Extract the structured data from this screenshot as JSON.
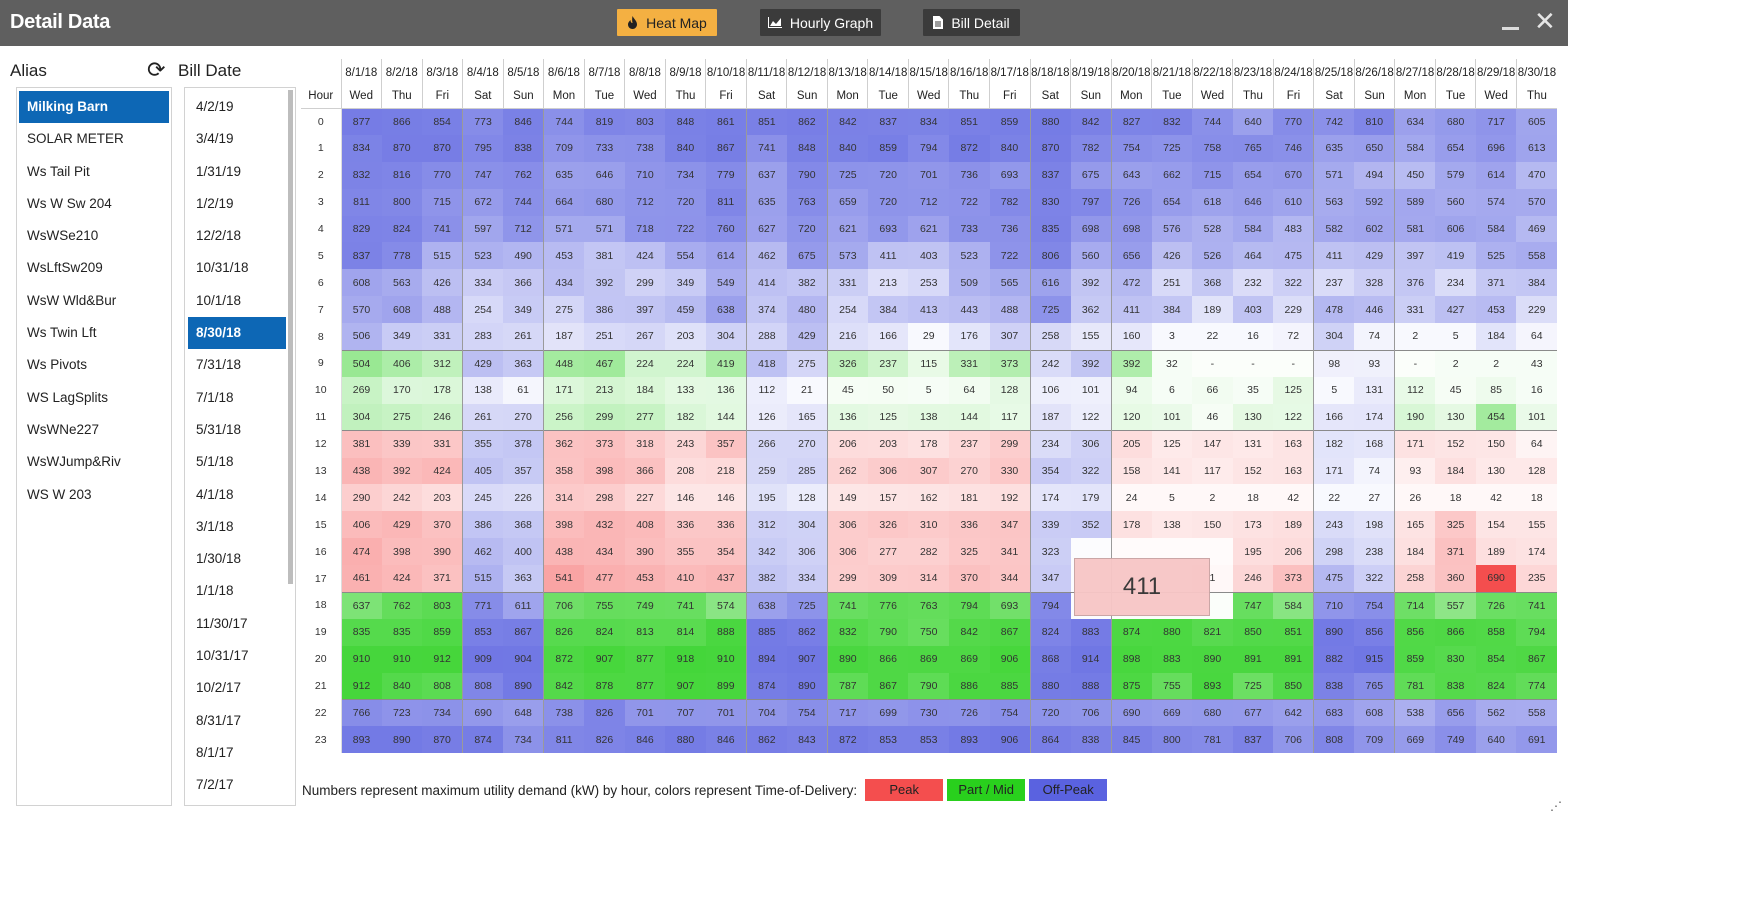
{
  "window": {
    "title": "Detail Data"
  },
  "toolbar": {
    "heat_map": "Heat Map",
    "hourly_graph": "Hourly Graph",
    "bill_detail": "Bill Detail"
  },
  "alias": {
    "heading": "Alias",
    "items": [
      "Milking Barn",
      "SOLAR METER",
      "Ws Tail Pit",
      "Ws W Sw 204",
      "WsWSe210",
      "WsLftSw209",
      "WsW Wld&Bur",
      "Ws Twin Lft",
      "Ws Pivots",
      "WS LagSplits",
      "WsWNe227",
      "WsWJump&Riv",
      "WS W 203"
    ],
    "selected_index": 0
  },
  "bill": {
    "heading": "Bill Date",
    "items": [
      "4/2/19",
      "3/4/19",
      "1/31/19",
      "1/2/19",
      "12/2/18",
      "10/31/18",
      "10/1/18",
      "8/30/18",
      "7/31/18",
      "7/1/18",
      "5/31/18",
      "5/1/18",
      "4/1/18",
      "3/1/18",
      "1/30/18",
      "1/1/18",
      "11/30/17",
      "10/31/17",
      "10/2/17",
      "8/31/17",
      "8/1/17",
      "7/2/17"
    ],
    "selected_index": 7
  },
  "heatmap": {
    "hour_label": "Hour",
    "dates": [
      "8/1/18",
      "8/2/18",
      "8/3/18",
      "8/4/18",
      "8/5/18",
      "8/6/18",
      "8/7/18",
      "8/8/18",
      "8/9/18",
      "8/10/18",
      "8/11/18",
      "8/12/18",
      "8/13/18",
      "8/14/18",
      "8/15/18",
      "8/16/18",
      "8/17/18",
      "8/18/18",
      "8/19/18",
      "8/20/18",
      "8/21/18",
      "8/22/18",
      "8/23/18",
      "8/24/18",
      "8/25/18",
      "8/26/18",
      "8/27/18",
      "8/28/18",
      "8/29/18",
      "8/30/18"
    ],
    "days": [
      "Wed",
      "Thu",
      "Fri",
      "Sat",
      "Sun",
      "Mon",
      "Tue",
      "Wed",
      "Thu",
      "Fri",
      "Sat",
      "Sun",
      "Mon",
      "Tue",
      "Wed",
      "Thu",
      "Fri",
      "Sat",
      "Sun",
      "Mon",
      "Tue",
      "Wed",
      "Thu",
      "Fri",
      "Sat",
      "Sun",
      "Mon",
      "Tue",
      "Wed",
      "Thu"
    ],
    "rows": [
      [
        "877",
        "866",
        "854",
        "773",
        "846",
        "744",
        "819",
        "803",
        "848",
        "861",
        "851",
        "862",
        "842",
        "837",
        "834",
        "851",
        "859",
        "880",
        "842",
        "827",
        "832",
        "744",
        "640",
        "770",
        "742",
        "810",
        "634",
        "680",
        "717",
        "605"
      ],
      [
        "834",
        "870",
        "870",
        "795",
        "838",
        "709",
        "733",
        "738",
        "840",
        "867",
        "741",
        "848",
        "840",
        "859",
        "794",
        "872",
        "840",
        "870",
        "782",
        "754",
        "725",
        "758",
        "765",
        "746",
        "635",
        "650",
        "584",
        "654",
        "696",
        "613"
      ],
      [
        "832",
        "816",
        "770",
        "747",
        "762",
        "635",
        "646",
        "710",
        "734",
        "779",
        "637",
        "790",
        "725",
        "720",
        "701",
        "736",
        "693",
        "837",
        "675",
        "643",
        "662",
        "715",
        "654",
        "670",
        "571",
        "494",
        "450",
        "579",
        "614",
        "470"
      ],
      [
        "811",
        "800",
        "715",
        "672",
        "744",
        "664",
        "680",
        "712",
        "720",
        "811",
        "635",
        "763",
        "659",
        "720",
        "712",
        "722",
        "782",
        "830",
        "797",
        "726",
        "654",
        "618",
        "646",
        "610",
        "563",
        "592",
        "589",
        "560",
        "574",
        "570"
      ],
      [
        "829",
        "824",
        "741",
        "597",
        "712",
        "571",
        "571",
        "718",
        "722",
        "760",
        "627",
        "720",
        "621",
        "693",
        "621",
        "733",
        "736",
        "835",
        "698",
        "698",
        "576",
        "528",
        "584",
        "483",
        "582",
        "602",
        "581",
        "606",
        "584",
        "469"
      ],
      [
        "837",
        "778",
        "515",
        "523",
        "490",
        "453",
        "381",
        "424",
        "554",
        "614",
        "462",
        "675",
        "573",
        "411",
        "403",
        "523",
        "722",
        "806",
        "560",
        "656",
        "426",
        "526",
        "464",
        "475",
        "411",
        "429",
        "397",
        "419",
        "525",
        "558"
      ],
      [
        "608",
        "563",
        "426",
        "334",
        "366",
        "434",
        "392",
        "299",
        "349",
        "549",
        "414",
        "382",
        "331",
        "213",
        "253",
        "509",
        "565",
        "616",
        "392",
        "472",
        "251",
        "368",
        "232",
        "322",
        "237",
        "328",
        "376",
        "234",
        "371",
        "384"
      ],
      [
        "570",
        "608",
        "488",
        "254",
        "349",
        "275",
        "386",
        "397",
        "459",
        "638",
        "374",
        "480",
        "254",
        "384",
        "413",
        "443",
        "488",
        "725",
        "362",
        "411",
        "384",
        "189",
        "403",
        "229",
        "478",
        "446",
        "331",
        "427",
        "453",
        "229"
      ],
      [
        "506",
        "349",
        "331",
        "283",
        "261",
        "187",
        "251",
        "267",
        "203",
        "304",
        "288",
        "429",
        "216",
        "166",
        "29",
        "176",
        "307",
        "258",
        "155",
        "160",
        "3",
        "22",
        "16",
        "72",
        "304",
        "74",
        "2",
        "5",
        "184",
        "64"
      ],
      [
        "504",
        "406",
        "312",
        "429",
        "363",
        "448",
        "467",
        "224",
        "224",
        "419",
        "418",
        "275",
        "326",
        "237",
        "115",
        "331",
        "373",
        "242",
        "392",
        "392",
        "32",
        "-",
        "-",
        "-",
        "98",
        "93",
        "-",
        "2",
        "2",
        "43"
      ],
      [
        "269",
        "170",
        "178",
        "138",
        "61",
        "171",
        "213",
        "184",
        "133",
        "136",
        "112",
        "21",
        "45",
        "50",
        "5",
        "64",
        "128",
        "106",
        "101",
        "94",
        "6",
        "66",
        "35",
        "125",
        "5",
        "131",
        "112",
        "45",
        "85",
        "16"
      ],
      [
        "304",
        "275",
        "246",
        "261",
        "270",
        "256",
        "299",
        "277",
        "182",
        "144",
        "126",
        "165",
        "136",
        "125",
        "138",
        "144",
        "117",
        "187",
        "122",
        "120",
        "101",
        "46",
        "130",
        "122",
        "166",
        "174",
        "190",
        "130",
        "454",
        "101"
      ],
      [
        "381",
        "339",
        "331",
        "355",
        "378",
        "362",
        "373",
        "318",
        "243",
        "357",
        "266",
        "270",
        "206",
        "203",
        "178",
        "237",
        "299",
        "234",
        "306",
        "205",
        "125",
        "147",
        "131",
        "163",
        "182",
        "168",
        "171",
        "152",
        "150",
        "64"
      ],
      [
        "438",
        "392",
        "424",
        "405",
        "357",
        "358",
        "398",
        "366",
        "208",
        "218",
        "259",
        "285",
        "262",
        "306",
        "307",
        "270",
        "330",
        "354",
        "322",
        "158",
        "141",
        "117",
        "152",
        "163",
        "171",
        "74",
        "93",
        "184",
        "130",
        "128"
      ],
      [
        "290",
        "242",
        "203",
        "245",
        "226",
        "314",
        "298",
        "227",
        "146",
        "146",
        "195",
        "128",
        "149",
        "157",
        "162",
        "181",
        "192",
        "174",
        "179",
        "24",
        "5",
        "2",
        "18",
        "42",
        "22",
        "27",
        "26",
        "18",
        "42",
        "18"
      ],
      [
        "406",
        "429",
        "370",
        "386",
        "368",
        "398",
        "432",
        "408",
        "336",
        "336",
        "312",
        "304",
        "306",
        "326",
        "310",
        "336",
        "347",
        "339",
        "352",
        "178",
        "138",
        "150",
        "173",
        "189",
        "243",
        "198",
        "165",
        "325",
        "154",
        "155"
      ],
      [
        "474",
        "398",
        "390",
        "462",
        "400",
        "438",
        "434",
        "390",
        "355",
        "354",
        "342",
        "306",
        "306",
        "277",
        "282",
        "325",
        "341",
        "323",
        "",
        "",
        "",
        "",
        "195",
        "206",
        "298",
        "238",
        "184",
        "371",
        "189",
        "174"
      ],
      [
        "461",
        "424",
        "371",
        "515",
        "363",
        "541",
        "477",
        "453",
        "410",
        "437",
        "382",
        "334",
        "299",
        "309",
        "314",
        "370",
        "344",
        "347",
        "",
        "",
        "",
        "1",
        "246",
        "373",
        "475",
        "322",
        "258",
        "360",
        "690",
        "235"
      ],
      [
        "637",
        "762",
        "803",
        "771",
        "611",
        "706",
        "755",
        "749",
        "741",
        "574",
        "638",
        "725",
        "741",
        "776",
        "763",
        "794",
        "693",
        "794",
        "",
        "",
        "",
        "",
        "747",
        "584",
        "710",
        "754",
        "714",
        "557",
        "726",
        "741"
      ],
      [
        "835",
        "835",
        "859",
        "853",
        "867",
        "826",
        "824",
        "813",
        "814",
        "888",
        "885",
        "862",
        "832",
        "790",
        "750",
        "842",
        "867",
        "824",
        "883",
        "874",
        "880",
        "821",
        "850",
        "851",
        "890",
        "856",
        "856",
        "866",
        "858",
        "794"
      ],
      [
        "910",
        "910",
        "912",
        "909",
        "904",
        "872",
        "907",
        "877",
        "918",
        "910",
        "894",
        "907",
        "890",
        "866",
        "869",
        "869",
        "906",
        "868",
        "914",
        "898",
        "883",
        "890",
        "891",
        "891",
        "882",
        "915",
        "859",
        "830",
        "854",
        "867"
      ],
      [
        "912",
        "840",
        "808",
        "808",
        "890",
        "842",
        "878",
        "877",
        "907",
        "899",
        "874",
        "890",
        "787",
        "867",
        "790",
        "886",
        "885",
        "880",
        "888",
        "875",
        "755",
        "893",
        "725",
        "850",
        "838",
        "765",
        "781",
        "838",
        "824",
        "774"
      ],
      [
        "766",
        "723",
        "734",
        "690",
        "648",
        "738",
        "826",
        "701",
        "707",
        "701",
        "704",
        "754",
        "717",
        "699",
        "730",
        "726",
        "754",
        "720",
        "706",
        "690",
        "669",
        "680",
        "677",
        "642",
        "683",
        "608",
        "538",
        "656",
        "562",
        "558"
      ],
      [
        "893",
        "890",
        "870",
        "874",
        "734",
        "811",
        "826",
        "846",
        "880",
        "846",
        "862",
        "843",
        "872",
        "853",
        "853",
        "893",
        "906",
        "864",
        "838",
        "845",
        "800",
        "781",
        "837",
        "706",
        "808",
        "709",
        "669",
        "749",
        "640",
        "691"
      ]
    ],
    "hour_tod": [
      "off",
      "off",
      "off",
      "off",
      "off",
      "off",
      "off",
      "off",
      "off",
      "mid",
      "mid",
      "mid",
      "peak",
      "peak",
      "peak",
      "peak",
      "peak",
      "peak",
      "mid",
      "mid",
      "mid",
      "mid",
      "off",
      "off"
    ],
    "weekend_offpeak_days": [
      "Sat",
      "Sun"
    ],
    "highlight_cell": {
      "hour": 17,
      "col": 28,
      "color": "#f44e4e"
    },
    "tooltip": "411"
  },
  "legend": {
    "note": "Numbers represent maximum utility demand (kW) by hour, colors represent Time-of-Delivery:",
    "peak": "Peak",
    "mid": "Part / Mid",
    "offpeak": "Off-Peak"
  },
  "colors": {
    "peak": "#f44e4e",
    "mid": "#29d01d",
    "offpeak": "#5a62e0",
    "heat_map_btn": "#f4b042",
    "selected_bg": "#0d67b5",
    "titlebar": "#5f5f5f"
  }
}
